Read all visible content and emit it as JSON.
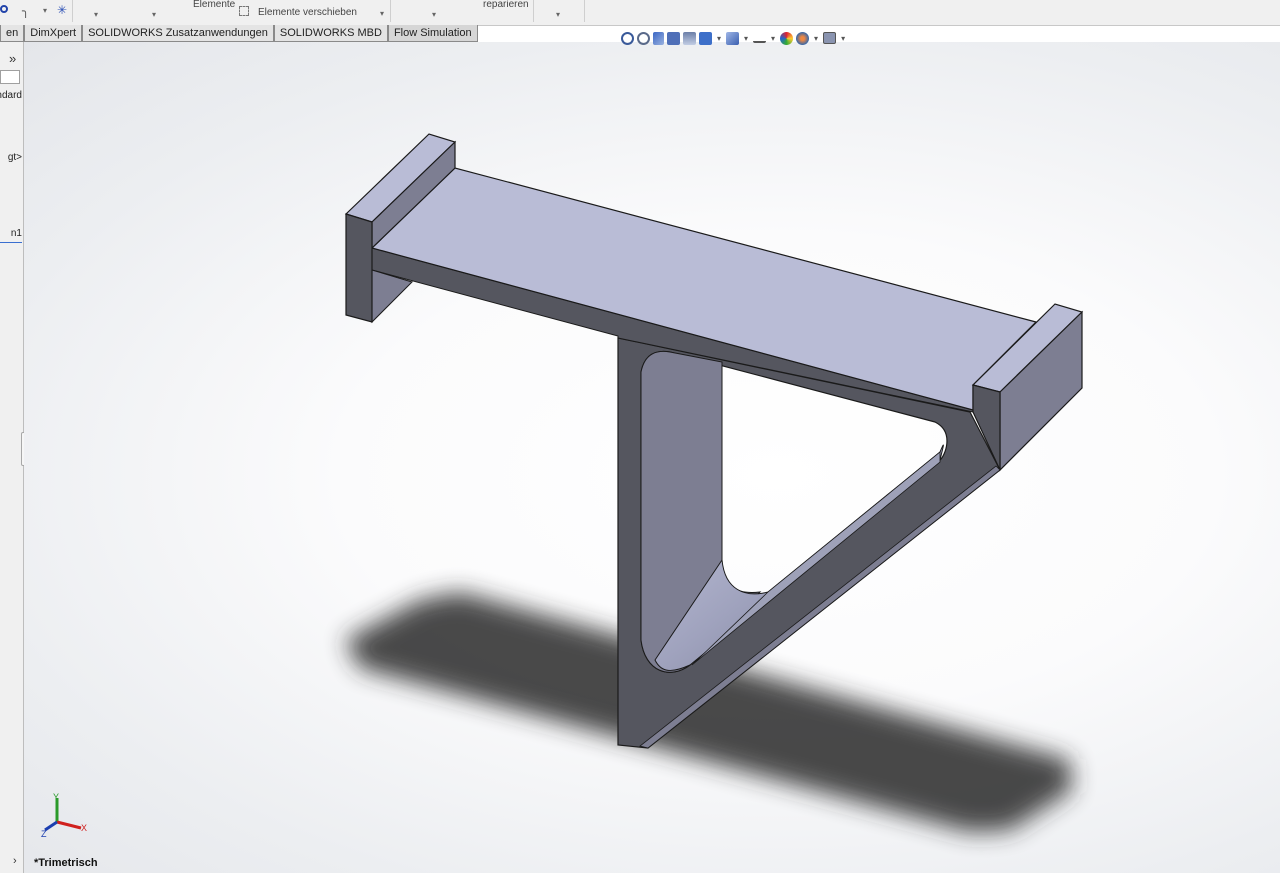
{
  "ribbon": {
    "elemente": "Elemente",
    "elemente_verschieben": "Elemente verschieben",
    "reparieren": "reparieren"
  },
  "tabs": [
    {
      "label": "en"
    },
    {
      "label": "DimXpert"
    },
    {
      "label": "SOLIDWORKS Zusatzanwendungen"
    },
    {
      "label": "SOLIDWORKS MBD"
    },
    {
      "label": "Flow Simulation"
    }
  ],
  "left_panel": {
    "expand_glyph": "»",
    "frag1": "ndard",
    "frag2": "gt>",
    "frag3": "n1"
  },
  "viewport": {
    "view_label": "*Trimetrisch",
    "triad": {
      "x": "X",
      "y": "Y",
      "z": "Z"
    }
  },
  "colors": {
    "face_top": "#b9bcd6",
    "face_front": "#55565f",
    "face_side": "#7d7e92",
    "shadow": "#2c2c2c",
    "triad_x": "#d0201e",
    "triad_y": "#2a9a2a",
    "triad_z": "#1c3fb0"
  }
}
